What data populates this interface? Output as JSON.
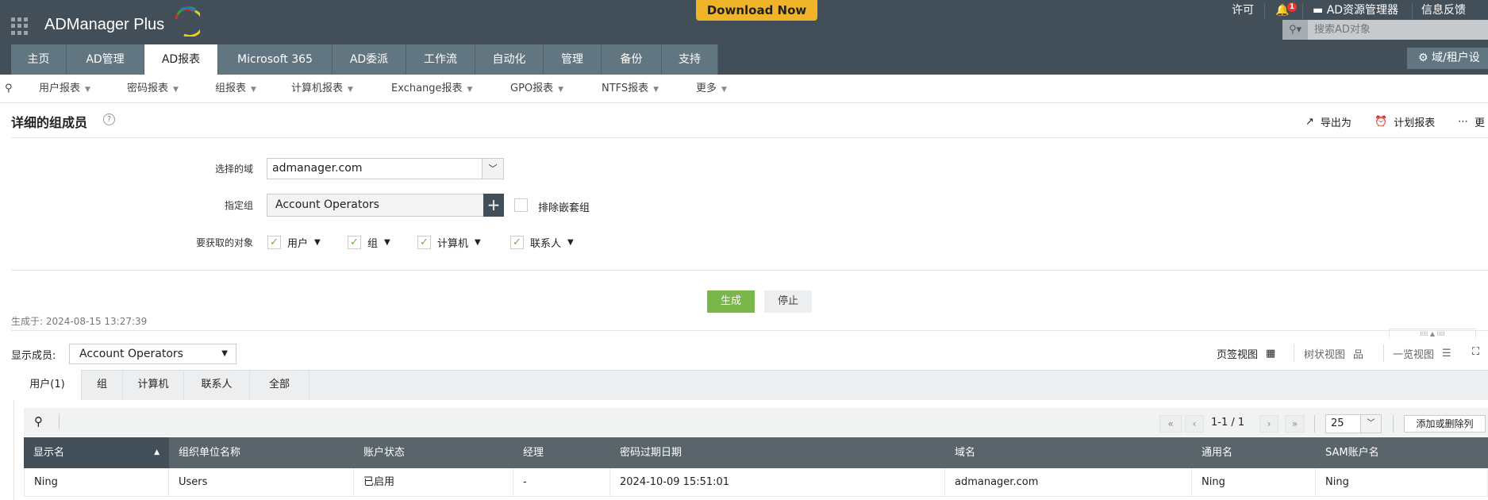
{
  "app": {
    "logo": "ADManager Plus",
    "download": "Download Now"
  },
  "topright": {
    "license": "许可",
    "notif_count": "1",
    "ad_explorer": "AD资源管理器",
    "feedback": "信息反馈",
    "search_placeholder": "搜索AD对象",
    "domain_settings": "域/租户设"
  },
  "tabs": [
    "主页",
    "AD管理",
    "AD报表",
    "Microsoft 365",
    "AD委派",
    "工作流",
    "自动化",
    "管理",
    "备份",
    "支持"
  ],
  "subnav": [
    "用户报表",
    "密码报表",
    "组报表",
    "计算机报表",
    "Exchange报表",
    "GPO报表",
    "NTFS报表",
    "更多"
  ],
  "page": {
    "title": "详细的组成员",
    "export": "导出为",
    "schedule": "计划报表",
    "more": "更"
  },
  "form": {
    "domain_label": "选择的域",
    "domain_value": "admanager.com",
    "group_label": "指定组",
    "group_value": "Account Operators",
    "exclude_nested": "排除嵌套组",
    "objects_label": "要获取的对象",
    "objects": [
      "用户",
      "组",
      "计算机",
      "联系人"
    ]
  },
  "actions": {
    "generate": "生成",
    "stop": "停止"
  },
  "generated": "生成于: 2024-08-15 13:27:39",
  "show_members": {
    "label": "显示成员:",
    "value": "Account Operators"
  },
  "views": {
    "tab": "页签视图",
    "tree": "树状视图",
    "list": "一览视图"
  },
  "result_tabs": [
    "用户(1)",
    "组",
    "计算机",
    "联系人",
    "全部"
  ],
  "pagination": {
    "range": "1-1 / 1",
    "page_size": "25",
    "add_remove_cols": "添加或删除列"
  },
  "table": {
    "columns": [
      "显示名",
      "组织单位名称",
      "账户状态",
      "经理",
      "密码过期日期",
      "域名",
      "通用名",
      "SAM账户名"
    ],
    "rows": [
      [
        "Ning",
        "Users",
        "已启用",
        "-",
        "2024-10-09 15:51:01",
        "admanager.com",
        "Ning",
        "Ning"
      ]
    ]
  }
}
